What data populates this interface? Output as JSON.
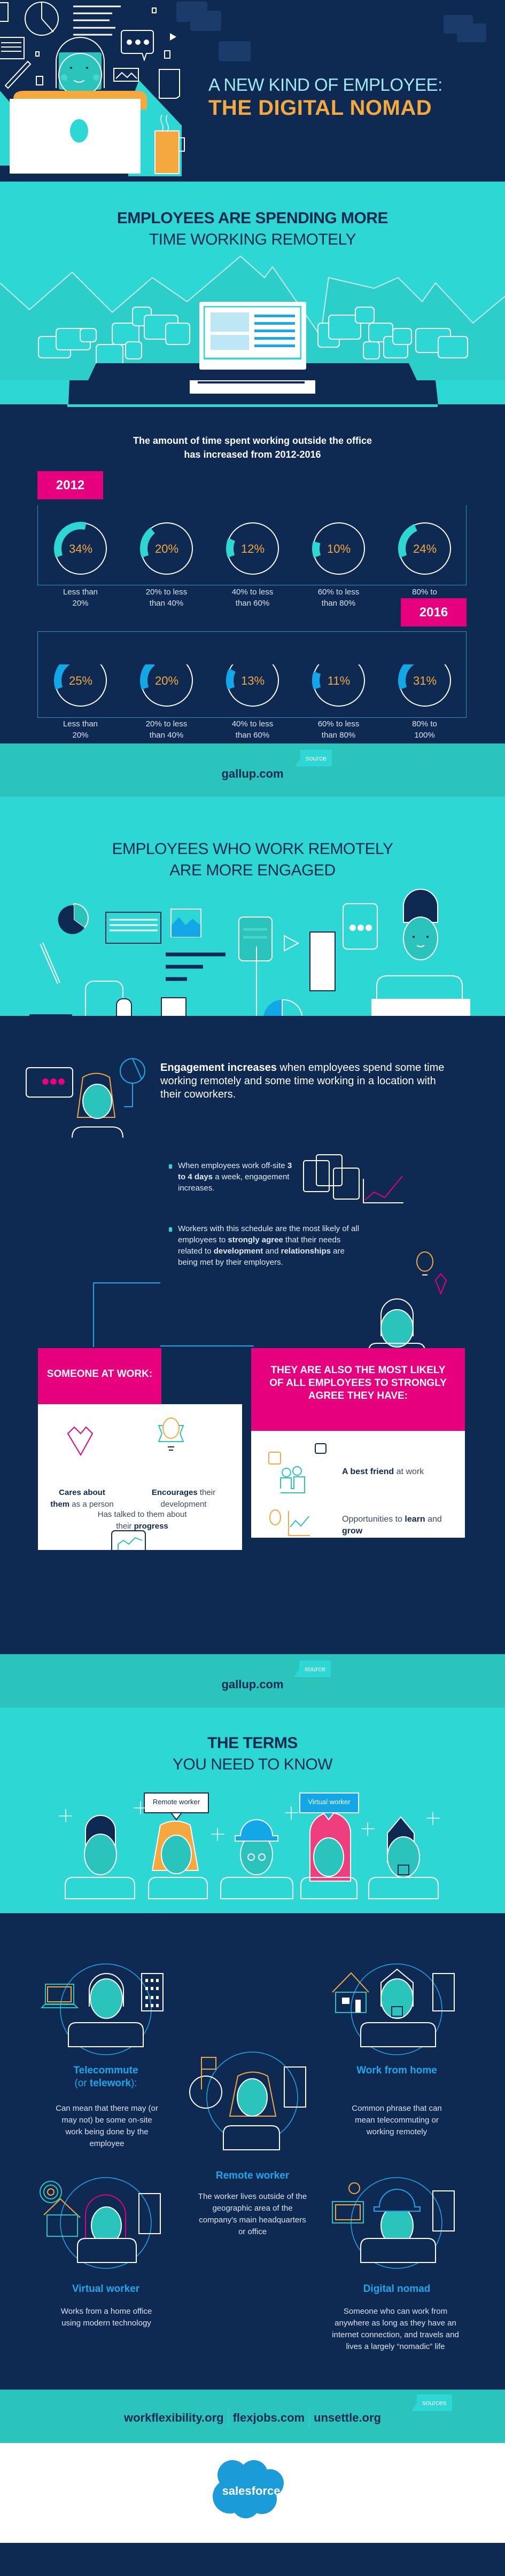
{
  "hero": {
    "title_line1": "A NEW KIND OF EMPLOYEE:",
    "title_line2": "THE DIGITAL NOMAD"
  },
  "remote_section": {
    "title_line1": "EMPLOYEES ARE SPENDING MORE",
    "title_line2": "TIME WORKING REMOTELY"
  },
  "stats": {
    "intro_line1": "The amount of time spent working outside the office",
    "intro_line2": "has increased from 2012-2016"
  },
  "chart_data": [
    {
      "type": "pie",
      "title": "2012",
      "categories": [
        "Less than 20%",
        "20% to less than 40%",
        "40% to less than 60%",
        "60% to less than 80%",
        "80% to 100%"
      ],
      "values": [
        34,
        20,
        12,
        10,
        24
      ],
      "labels": [
        "34%",
        "20%",
        "12%",
        "10%",
        "24%"
      ],
      "arc_color": "#2dd8d4"
    },
    {
      "type": "pie",
      "title": "2016",
      "categories": [
        "Less than 20%",
        "20% to less than 40%",
        "40% to less than 60%",
        "60% to less than 80%",
        "80% to 100%"
      ],
      "values": [
        25,
        20,
        13,
        11,
        31
      ],
      "labels": [
        "25%",
        "20%",
        "13%",
        "11%",
        "31%"
      ],
      "arc_color": "#12a8e8"
    }
  ],
  "ring_labels": [
    [
      "Less than",
      "20%"
    ],
    [
      "20% to less",
      "than 40%"
    ],
    [
      "40% to less",
      "than 60%"
    ],
    [
      "60% to less",
      "than 80%"
    ],
    [
      "80% to",
      "100%"
    ]
  ],
  "sources": {
    "tag": "source",
    "tag_plural": "sources",
    "gallup": "gallup.com",
    "final": [
      "workflexibility.org",
      "flexjobs.com",
      "unsettle.org"
    ]
  },
  "engaged_section": {
    "title_line1": "EMPLOYEES WHO WORK REMOTELY",
    "title_line2": "ARE MORE ENGAGED"
  },
  "engagement": {
    "lead_bold": "Engagement increases",
    "lead_rest": " when employees spend some time working remotely and some time working in a location with their coworkers.",
    "bullet1_pre": "When employees work off-site ",
    "bullet1_bold": "3 to 4 days",
    "bullet1_post": " a week, engagement increases.",
    "bullet2_a": "Workers with this schedule are the most likely of all employees to ",
    "bullet2_b": "strongly agree",
    "bullet2_c": " that their needs related to ",
    "bullet2_d": "development",
    "bullet2_e": " and ",
    "bullet2_f": "relationships",
    "bullet2_g": " are being met by their employers.",
    "someone_header": "SOMEONE AT WORK:",
    "someone_items": [
      {
        "bold": "Cares about them",
        "rest": " as a person"
      },
      {
        "bold": "Encourages",
        "rest": " their development"
      },
      {
        "pre": "Has talked to them about their ",
        "bold": "progress"
      }
    ],
    "likely_header": "THEY ARE ALSO THE MOST LIKELY OF ALL EMPLOYEES TO STRONGLY AGREE THEY HAVE:",
    "likely_items": [
      {
        "bold": "A best friend",
        "rest": " at work"
      },
      {
        "pre": "Opportunities to ",
        "bold1": "learn",
        "mid": " and ",
        "bold2": "grow"
      }
    ]
  },
  "terms_section": {
    "title_line1": "THE TERMS",
    "title_line2": "YOU NEED TO KNOW",
    "bubble_remote": "Remote worker",
    "bubble_virtual": "Virtual worker"
  },
  "terms": [
    {
      "title": "Telecommute",
      "subtitle_pre": "(or ",
      "subtitle_bold": "telework",
      "subtitle_post": "):",
      "desc": "Can mean that there may (or may not) be some on-site work being done by the employee"
    },
    {
      "title": "Work from home",
      "desc": "Common phrase that can mean telecommuting or working remotely"
    },
    {
      "title": "Remote worker",
      "desc": "The worker lives outside of the geographic area of the company's main headquarters or office"
    },
    {
      "title": "Virtual worker",
      "desc": "Works from a home office using modern technology"
    },
    {
      "title": "Digital nomad",
      "desc": "Someone who can work from anywhere as long as they have an internet connection, and travels and lives a largely “nomadic” life"
    }
  ],
  "footer": {
    "logo_text": "salesforce"
  },
  "colors": {
    "navy": "#0f2a52",
    "teal": "#2dd8d4",
    "pink": "#e6007e",
    "orange": "#f5a83d",
    "blue": "#12a8e8"
  }
}
